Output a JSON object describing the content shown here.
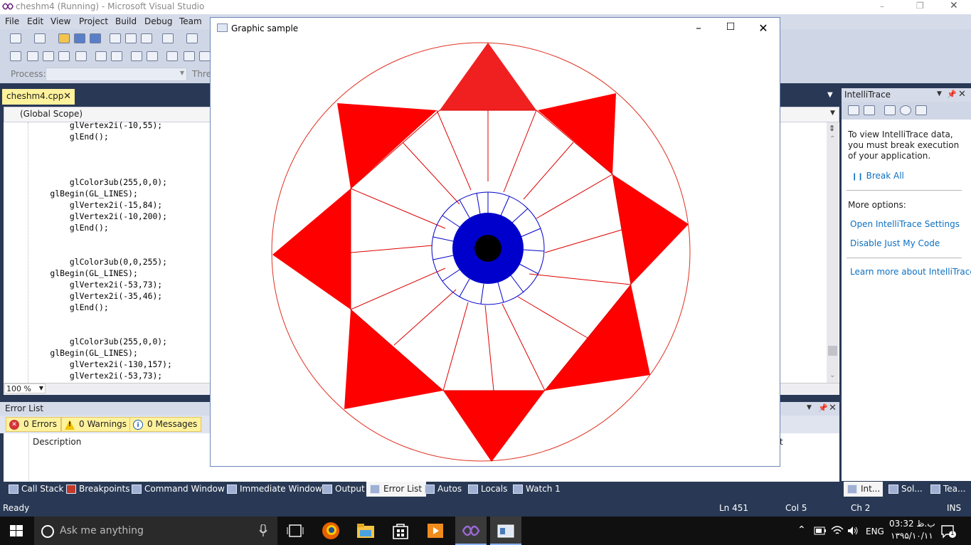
{
  "vs": {
    "title": "cheshm4 (Running) - Microsoft Visual Studio",
    "menu": [
      "File",
      "Edit",
      "View",
      "Project",
      "Build",
      "Debug",
      "Team"
    ],
    "process_label": "Process:",
    "threads_label": "Threa",
    "doc_tab": "cheshm4.cpp",
    "scope": "(Global Scope)",
    "zoom": "100 %",
    "code_lines": [
      "        glVertex2i(-10,55);",
      "        glEnd();",
      "",
      "",
      "",
      "        glColor3ub(255,0,0);",
      "    glBegin(GL_LINES);",
      "        glVertex2i(-15,84);",
      "        glVertex2i(-10,200);",
      "        glEnd();",
      "",
      "",
      "        glColor3ub(0,0,255);",
      "    glBegin(GL_LINES);",
      "        glVertex2i(-53,73);",
      "        glVertex2i(-35,46);",
      "        glEnd();",
      "",
      "",
      "        glColor3ub(255,0,0);",
      "    glBegin(GL_LINES);",
      "        glVertex2i(-130,157);",
      "        glVertex2i(-53,73);"
    ],
    "error_list": {
      "title": "Error List",
      "errors": "0 Errors",
      "warnings": "0 Warnings",
      "messages": "0 Messages",
      "description_col": "Description",
      "partial_col": "t"
    },
    "bottom_tabs": [
      "Call Stack",
      "Breakpoints",
      "Command Window",
      "Immediate Window",
      "Output",
      "Error List",
      "Autos",
      "Locals",
      "Watch 1"
    ],
    "active_bottom_tab": "Error List",
    "intellitrace": {
      "title": "IntelliTrace",
      "info": "To view IntelliTrace data, you must break execution of your application.",
      "break_all": "Break All",
      "more_options": "More options:",
      "open_settings": "Open IntelliTrace Settings",
      "disable_jmc": "Disable Just My Code",
      "learn_more": "Learn more about IntelliTrace",
      "tabs": [
        "Int...",
        "Sol...",
        "Tea..."
      ]
    },
    "status": {
      "ready": "Ready",
      "ln": "Ln 451",
      "col": "Col 5",
      "ch": "Ch 2",
      "ins": "INS"
    }
  },
  "graphic_window": {
    "title": "Graphic sample"
  },
  "taskbar": {
    "search_placeholder": "Ask me anything",
    "lang": "ENG",
    "time": "03:32 ب.ظ",
    "date": "۱۳۹۵/۱۰/۱۱",
    "notifications": "1"
  },
  "colors": {
    "red": "#ff0000",
    "blue": "#0000cc",
    "vs_navy": "#293955",
    "tab_yellow": "#fff29d"
  }
}
